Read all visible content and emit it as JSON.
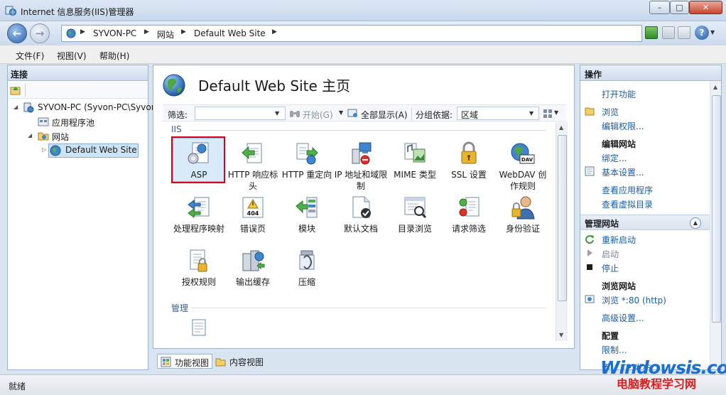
{
  "window": {
    "title": "Internet 信息服务(IIS)管理器",
    "minimize": "–",
    "maximize": "□",
    "close": "✕"
  },
  "address": {
    "crumbs": [
      "SYVON-PC",
      "网站",
      "Default Web Site"
    ],
    "help": "?"
  },
  "menu": {
    "items": [
      "文件(F)",
      "视图(V)",
      "帮助(H)"
    ]
  },
  "connections": {
    "header": "连接",
    "tree": [
      {
        "label": "SYVON-PC (Syvon-PC\\Syvon",
        "level": 0
      },
      {
        "label": "应用程序池",
        "level": 1
      },
      {
        "label": "网站",
        "level": 1
      },
      {
        "label": "Default Web Site",
        "level": 2,
        "selected": true
      }
    ]
  },
  "center": {
    "title": "Default Web Site 主页",
    "filter_label": "筛选:",
    "start_label": "开始(G)",
    "show_all_label": "全部显示(A)",
    "group_by_label": "分组依据:",
    "group_by_value": "区域",
    "groups": [
      "IIS",
      "管理"
    ],
    "features": [
      {
        "label": "ASP",
        "icon": "asp-icon",
        "selected": true
      },
      {
        "label": "HTTP 响应标头",
        "icon": "http-response-headers-icon"
      },
      {
        "label": "HTTP 重定向",
        "icon": "http-redirect-icon"
      },
      {
        "label": "IP 地址和域限制",
        "icon": "ip-restrictions-icon"
      },
      {
        "label": "MIME 类型",
        "icon": "mime-types-icon"
      },
      {
        "label": "SSL 设置",
        "icon": "ssl-lock-icon"
      },
      {
        "label": "WebDAV 创作规则",
        "icon": "webdav-icon"
      },
      {
        "label": "处理程序映射",
        "icon": "handler-mappings-icon"
      },
      {
        "label": "错误页",
        "icon": "error-pages-icon"
      },
      {
        "label": "模块",
        "icon": "modules-icon"
      },
      {
        "label": "默认文档",
        "icon": "default-document-icon"
      },
      {
        "label": "目录浏览",
        "icon": "directory-browsing-icon"
      },
      {
        "label": "请求筛选",
        "icon": "request-filtering-icon"
      },
      {
        "label": "身份验证",
        "icon": "authentication-icon"
      },
      {
        "label": "授权规则",
        "icon": "authorization-rules-icon"
      },
      {
        "label": "输出缓存",
        "icon": "output-caching-icon"
      },
      {
        "label": "压缩",
        "icon": "compression-icon"
      }
    ],
    "error_page_badge": "404",
    "webdav_badge": "DAV",
    "tabs": [
      "功能视图",
      "内容视图"
    ]
  },
  "actions": {
    "header": "操作",
    "open_feature": "打开功能",
    "browse": "浏览",
    "edit_permissions": "编辑权限...",
    "edit_site_title": "编辑网站",
    "bindings": "绑定...",
    "basic_settings": "基本设置...",
    "view_applications": "查看应用程序",
    "view_virtual_dirs": "查看虚拟目录",
    "manage_site_section": "管理网站",
    "restart": "重新启动",
    "start": "启动",
    "stop": "停止",
    "browse_site_title": "浏览网站",
    "browse_port": "浏览 *:80 (http)",
    "advanced_settings": "高级设置...",
    "config_title": "配置",
    "limits": "限制...",
    "partial_link": "添... TP 发布..."
  },
  "status": {
    "text": "就绪"
  },
  "watermark": {
    "top": "Windowsis.com",
    "bottom": "电脑教程学习网"
  }
}
